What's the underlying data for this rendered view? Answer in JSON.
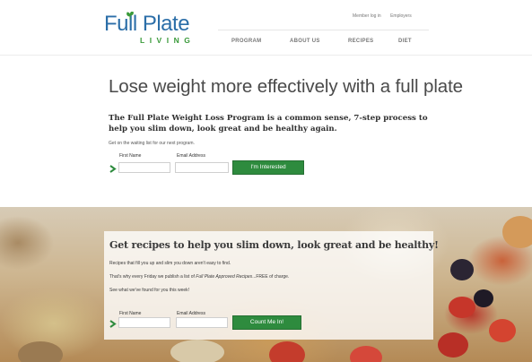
{
  "brand": {
    "logo_main": "Full Plate",
    "logo_sub": "LIVING",
    "primary_color": "#2b6ea8",
    "accent_color": "#3a9a3a"
  },
  "header": {
    "top_links": [
      "Member log in",
      "Employers"
    ],
    "nav": [
      "PROGRAM",
      "ABOUT US",
      "RECIPES",
      "DIET"
    ]
  },
  "hero": {
    "headline": "Lose weight more effectively with a full plate",
    "subhead": "The Full Plate Weight Loss Program is a common sense, 7-step process to help you slim down, look great and be healthy again.",
    "waiting_text": "Get on the waiting list for our next program.",
    "first_name_label": "First Name",
    "email_label": "Email Address",
    "first_name_value": "",
    "email_value": "",
    "button_label": "I'm Interested",
    "button_color": "#2e8b3e"
  },
  "recipes": {
    "title": "Get recipes to help you slim down, look great and be healthy!",
    "line1": "Recipes that fill you up and slim you down aren't easy to find.",
    "line2_pre": "That's why every Friday we publish a list of ",
    "line2_em": "Full Plate Approved Recipes",
    "line2_post": "...FREE of charge.",
    "line3": "See what we've found for you this week!",
    "first_name_label": "First Name",
    "email_label": "Email Address",
    "first_name_value": "",
    "email_value": "",
    "button_label": "Count Me In!"
  },
  "icons": {
    "chevron": "chevron-right-icon",
    "leaf": "leaf-icon"
  }
}
